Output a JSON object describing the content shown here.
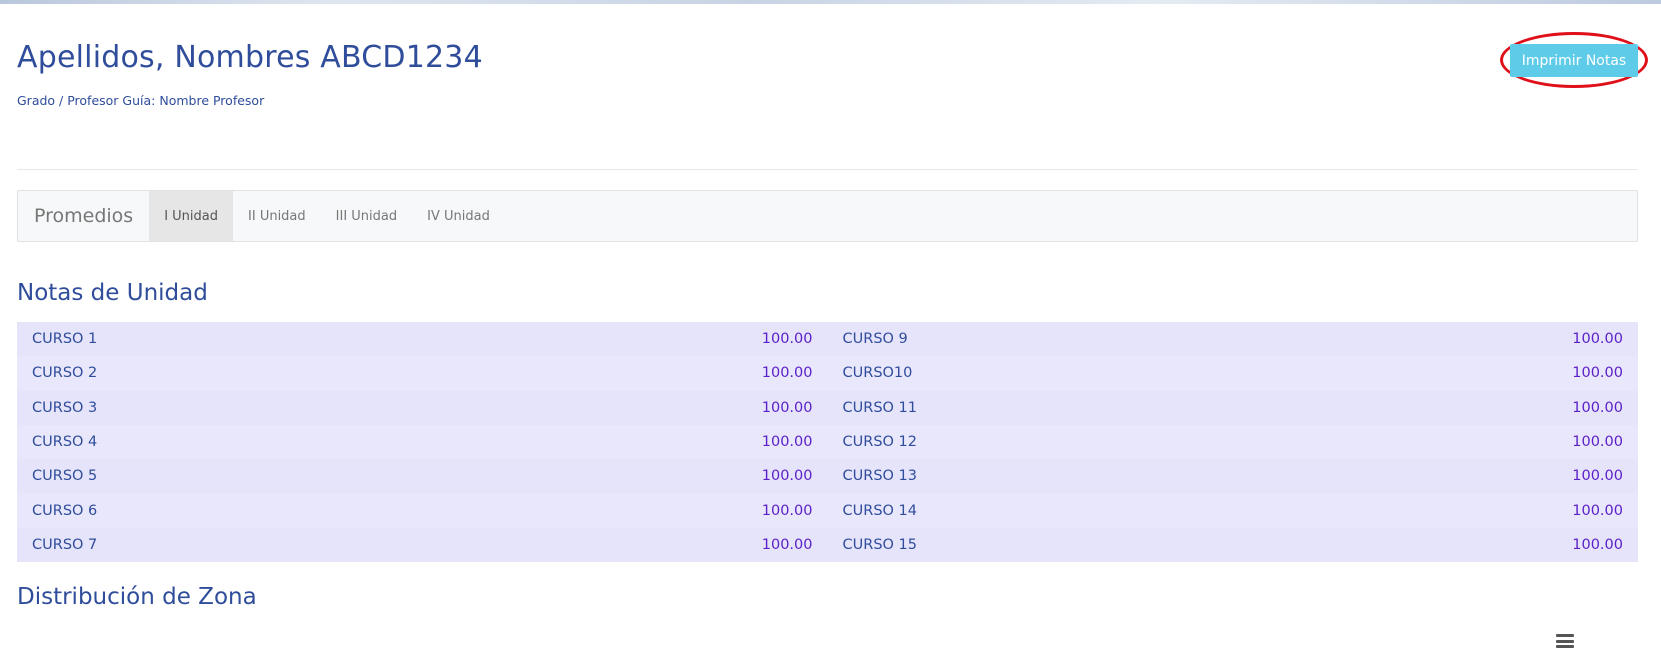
{
  "student": {
    "name": "Apellidos, Nombres ABCD1234",
    "subtitle": "Grado / Profesor Guía: Nombre Profesor"
  },
  "actions": {
    "print_label": "Imprimir Notas"
  },
  "nav": {
    "brand": "Promedios",
    "tabs": [
      {
        "label": "I Unidad",
        "active": true
      },
      {
        "label": "II Unidad",
        "active": false
      },
      {
        "label": "III Unidad",
        "active": false
      },
      {
        "label": "IV Unidad",
        "active": false
      }
    ]
  },
  "grades_section": {
    "title": "Notas de Unidad",
    "left": [
      {
        "course": "CURSO 1",
        "grade": "100.00"
      },
      {
        "course": "CURSO 2",
        "grade": "100.00"
      },
      {
        "course": "CURSO 3",
        "grade": "100.00"
      },
      {
        "course": "CURSO 4",
        "grade": "100.00"
      },
      {
        "course": "CURSO 5",
        "grade": "100.00"
      },
      {
        "course": "CURSO 6",
        "grade": "100.00"
      },
      {
        "course": "CURSO 7",
        "grade": "100.00"
      }
    ],
    "right": [
      {
        "course": "CURSO 9",
        "grade": "100.00"
      },
      {
        "course": "CURSO10",
        "grade": "100.00"
      },
      {
        "course": "CURSO 11",
        "grade": "100.00"
      },
      {
        "course": "CURSO 12",
        "grade": "100.00"
      },
      {
        "course": "CURSO 13",
        "grade": "100.00"
      },
      {
        "course": "CURSO 14",
        "grade": "100.00"
      },
      {
        "course": "CURSO 15",
        "grade": "100.00"
      }
    ]
  },
  "zone_section": {
    "title": "Distribución de Zona",
    "menu_icon": "hamburger-menu-icon"
  },
  "colors": {
    "accent_button": "#5ecbe8",
    "highlight_ellipse": "#e0101a",
    "grade_panel": "#e6e4fb",
    "grade_value": "#5b20c8",
    "heading": "#2f4d9b"
  }
}
